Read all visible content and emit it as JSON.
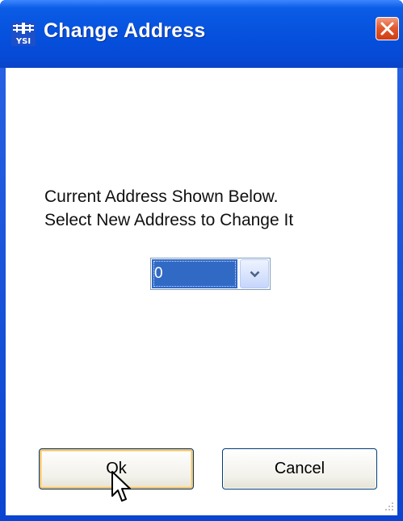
{
  "window": {
    "title": "Change Address",
    "icon": "ysi-app-icon",
    "icon_text": "YSI"
  },
  "dialog": {
    "prompt_line1": "Current Address Shown Below.",
    "prompt_line2": "Select New Address to Change It",
    "address_select": {
      "value": "0"
    }
  },
  "buttons": {
    "ok_label": "Ok",
    "cancel_label": "Cancel"
  },
  "colors": {
    "titlebar": "#0550dc",
    "selection": "#316ac5",
    "close": "#e25a2f"
  }
}
